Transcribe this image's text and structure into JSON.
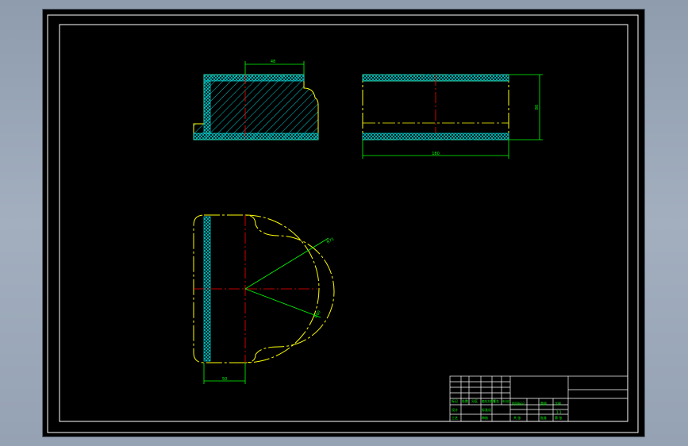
{
  "colors": {
    "background": "#000000",
    "outline": "#ffff00",
    "dimension": "#00ff00",
    "centerline": "#ff0000",
    "hatch": "#00c8c8",
    "frame": "#ffffff"
  },
  "dimensions": {
    "top_left_width": "48",
    "top_right_width": "180",
    "top_right_height": "80",
    "bottom_width": "50",
    "radius_outer": "R71",
    "radius_inner": "R60"
  },
  "title_block": {
    "row_labels": [
      "标记",
      "处数",
      "分区",
      "更改文件号",
      "签名",
      "年月日"
    ],
    "design_label": "设计",
    "standardize_label": "标准化",
    "stage_label": "阶段标记",
    "weight_label": "重量",
    "ratio_label": "比例",
    "ratio_value": "1:1",
    "review_label": "审核",
    "process_label": "工艺",
    "approve_label": "批准",
    "sheet_total": "共 张",
    "sheet_num": "第 张"
  }
}
